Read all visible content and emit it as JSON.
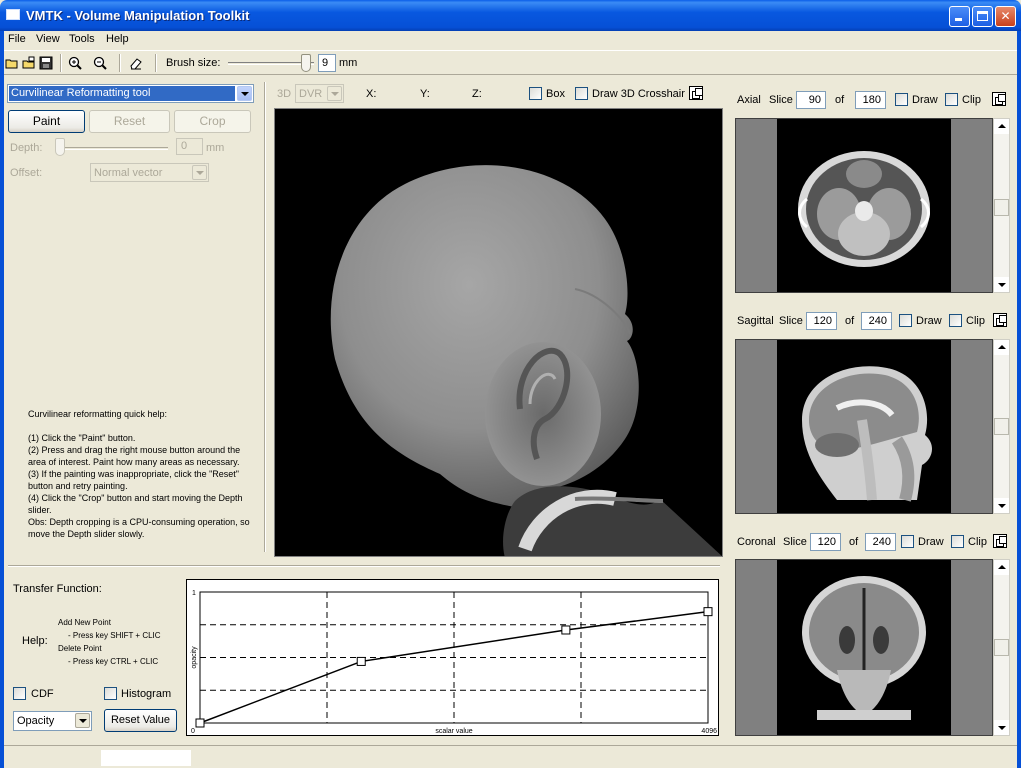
{
  "window": {
    "title": "VMTK - Volume Manipulation Toolkit"
  },
  "menu": [
    "File",
    "View",
    "Tools",
    "Help"
  ],
  "toolbar": {
    "icons": [
      "open-icon",
      "open-multiple-icon",
      "save-icon",
      "zoom-in-icon",
      "zoom-out-icon",
      "eraser-icon"
    ],
    "brush_label": "Brush size:",
    "brush_value": "9",
    "brush_unit": "mm"
  },
  "tools": {
    "selected": "Curvilinear Reformatting tool",
    "paint": "Paint",
    "reset": "Reset",
    "crop": "Crop",
    "depth_label": "Depth:",
    "depth_value": "0",
    "depth_unit": "mm",
    "offset_label": "Offset:",
    "offset_value": "Normal vector",
    "help": "Curvilinear reformatting quick help:\n\n(1) Click the \"Paint\" button.\n(2) Press and drag the right mouse button around the area of interest. Paint how many areas as necessary.\n(3) If the painting was inappropriate, click the \"Reset\" button and retry painting.\n(4) Click the \"Crop\" button and start moving the Depth slider.\nObs: Depth cropping is a CPU-consuming operation, so move the Depth slider slowly."
  },
  "view3d": {
    "mode_label": "3D",
    "mode": "DVR",
    "x_label": "X:",
    "y_label": "Y:",
    "z_label": "Z:",
    "box_label": "Box",
    "crosshair_label": "Draw 3D Crosshair"
  },
  "slices": [
    {
      "name": "Axial",
      "slice_label": "Slice",
      "value": "90",
      "of": "of",
      "total": "180",
      "draw": "Draw",
      "clip": "Clip"
    },
    {
      "name": "Sagittal",
      "slice_label": "Slice",
      "value": "120",
      "of": "of",
      "total": "240",
      "draw": "Draw",
      "clip": "Clip"
    },
    {
      "name": "Coronal",
      "slice_label": "Slice",
      "value": "120",
      "of": "of",
      "total": "240",
      "draw": "Draw",
      "clip": "Clip"
    }
  ],
  "transfer": {
    "title": "Transfer Function:",
    "help_label": "Help:",
    "help_add": "Add New Point",
    "help_add_key": "- Press key SHIFT + CLIC",
    "help_del": "Delete Point",
    "help_del_key": "- Press key CTRL + CLIC",
    "cdf": "CDF",
    "histogram": "Histogram",
    "mode": "Opacity",
    "reset": "Reset Value"
  },
  "chart_data": {
    "type": "line",
    "xlabel": "scalar value",
    "ylabel": "opacity",
    "xlim": [
      0,
      4096
    ],
    "ylim": [
      0,
      1
    ],
    "x_tick_labels": [
      "0",
      "4096"
    ],
    "y_tick_labels": [
      "1"
    ],
    "grid": true,
    "series": [
      {
        "x": [
          0,
          1300,
          2950,
          4096
        ],
        "y": [
          0.0,
          0.47,
          0.71,
          0.85
        ]
      }
    ]
  }
}
